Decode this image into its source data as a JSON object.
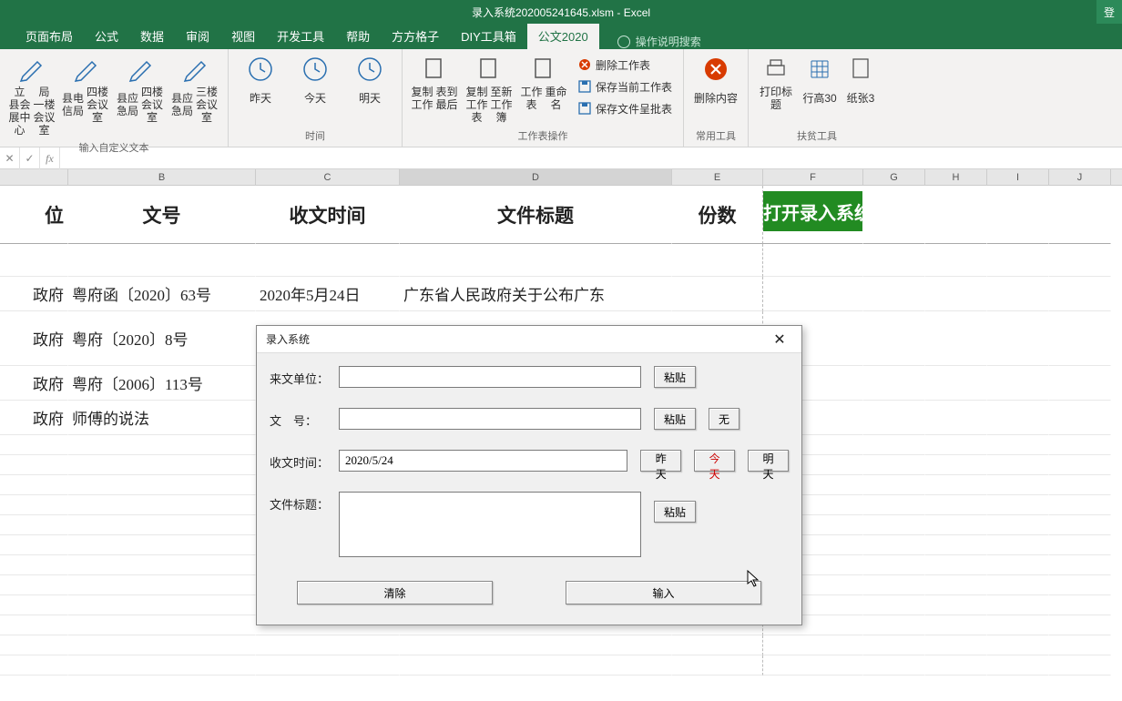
{
  "app": {
    "title": "录入系统202005241645.xlsm  -  Excel",
    "login_label": "登"
  },
  "tabs": [
    "页面布局",
    "公式",
    "数据",
    "审阅",
    "视图",
    "开发工具",
    "帮助",
    "方方格子",
    "DIY工具箱",
    "公文2020"
  ],
  "active_tab_index": 9,
  "tell_me_placeholder": "操作说明搜索",
  "ribbon": {
    "group1": {
      "label": "输入自定义文本",
      "buttons": [
        {
          "line1": "立 县会展中心",
          "line2": "局 一楼会议室"
        },
        {
          "line1": "县电信局",
          "line2": "四楼会议室"
        },
        {
          "line1": "县应急局",
          "line2": "四楼会议室"
        },
        {
          "line1": "县应急局",
          "line2": "三楼会议室"
        }
      ]
    },
    "group2": {
      "label": "时间",
      "buttons": [
        "昨天",
        "今天",
        "明天"
      ]
    },
    "group3": {
      "label": "工作表操作",
      "big": [
        {
          "line1": "复制工作",
          "line2": "表到最后"
        },
        {
          "line1": "复制工作表",
          "line2": "至新工作簿"
        },
        {
          "line1": "工作表",
          "line2": "重命名"
        }
      ],
      "small": [
        "删除工作表",
        "保存当前工作表",
        "保存文件呈批表"
      ]
    },
    "group4": {
      "label": "常用工具",
      "button": "删除内容"
    },
    "group5": {
      "label": "扶贫工具",
      "buttons": [
        "打印标题",
        "行高30",
        "纸张3"
      ]
    }
  },
  "namebox": "",
  "columns": [
    "B",
    "C",
    "D",
    "E",
    "F",
    "G",
    "H",
    "I",
    "J"
  ],
  "headers": {
    "A": "位",
    "B": "文号",
    "C": "收文时间",
    "D": "文件标题",
    "E": "份数",
    "F_button": "打开录入系统"
  },
  "rows": [
    {
      "A": "政府",
      "B": "粤府函〔2020〕63号",
      "C": "2020年5月24日",
      "D": "广东省人民政府关于公布广东"
    },
    {
      "A": "政府",
      "B": "粤府〔2020〕8号",
      "C": "",
      "D": ""
    },
    {
      "A": "政府",
      "B": "粤府〔2006〕113号",
      "C": "",
      "D": ""
    },
    {
      "A": "政府",
      "B": "师傅的说法",
      "C": "",
      "D": ""
    }
  ],
  "dialog": {
    "title": "录入系统",
    "labels": {
      "unit": "来文单位：",
      "no": "文　号：",
      "date": "收文时间：",
      "topic": "文件标题："
    },
    "values": {
      "unit": "",
      "no": "",
      "date": "2020/5/24",
      "topic": ""
    },
    "buttons": {
      "paste": "粘贴",
      "none": "无",
      "yesterday": "昨天",
      "today": "今天",
      "tomorrow": "明天",
      "clear": "清除",
      "submit": "输入"
    }
  }
}
